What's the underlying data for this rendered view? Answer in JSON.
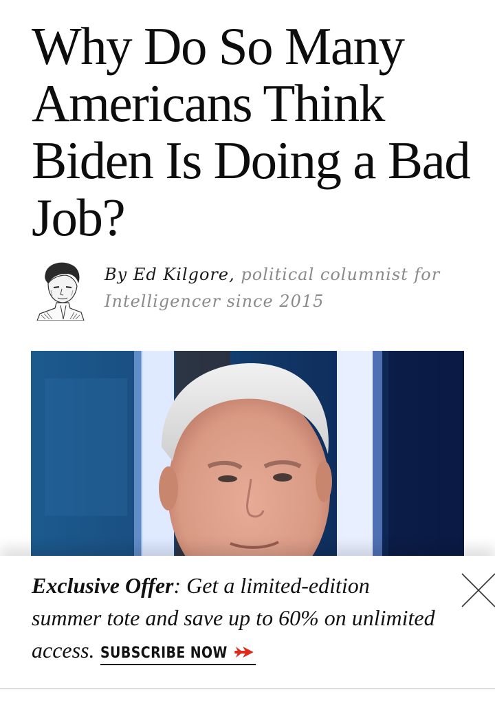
{
  "article": {
    "headline": "Why Do So Many Americans Think Biden Is Doing a Bad Job?",
    "byline": {
      "author": "By Ed Kilgore,",
      "description": "political columnist for Intelligencer since 2015"
    }
  },
  "icons": {
    "author_avatar": "author-portrait-illustration",
    "close": "close-icon",
    "subscribe_arrow": "double-chevron-right-icon"
  },
  "promo": {
    "offer_title": "Exclusive Offer",
    "offer_body": ": Get a limited-edition summer tote and save up to 60% on unlimited access.",
    "cta_label": "SUBSCRIBE NOW",
    "cta_arrow": "➤"
  },
  "colors": {
    "accent": "#e0281b",
    "byline_muted": "#8a8a8a",
    "text": "#111111"
  }
}
